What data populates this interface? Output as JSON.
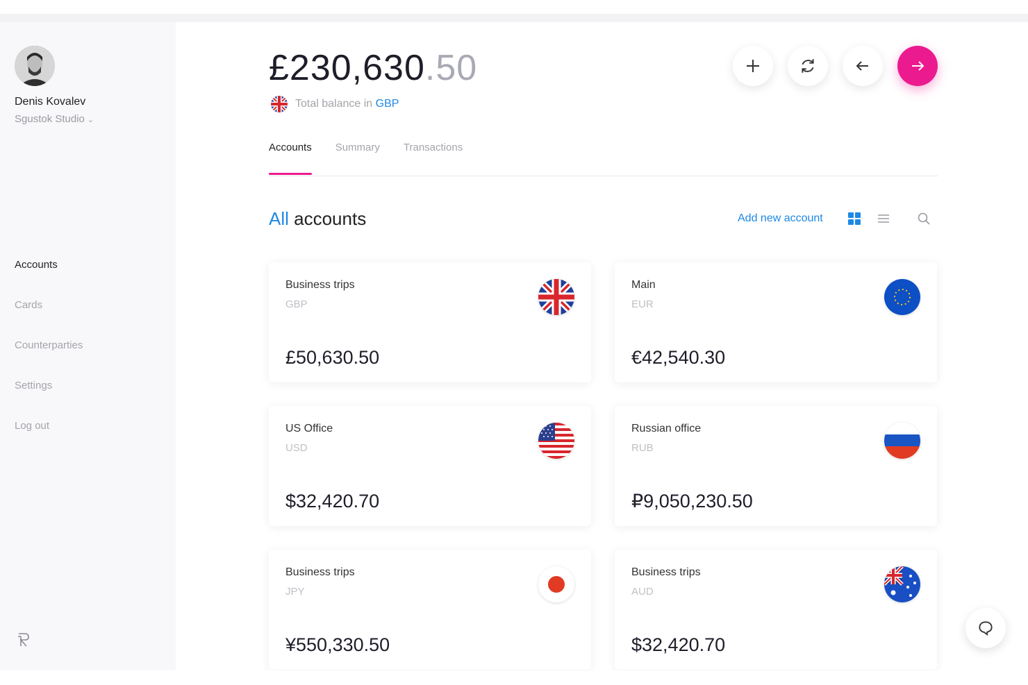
{
  "user": {
    "name": "Denis Kovalev",
    "org": "Sgustok Studio"
  },
  "nav": {
    "accounts": "Accounts",
    "cards": "Cards",
    "counterparties": "Counterparties",
    "settings": "Settings",
    "logout": "Log out"
  },
  "balance": {
    "whole": "£230,630",
    "cents": ".50",
    "label": "Total balance in",
    "currency": "GBP"
  },
  "tabs": {
    "accounts": "Accounts",
    "summary": "Summary",
    "transactions": "Transactions"
  },
  "section": {
    "highlight": "All",
    "rest": " accounts",
    "add_label": "Add new account"
  },
  "accounts": [
    {
      "name": "Business trips",
      "code": "GBP",
      "amount": "£50,630.50",
      "flag": "uk-flag-icon"
    },
    {
      "name": "Main",
      "code": "EUR",
      "amount": "€42,540.30",
      "flag": "eu-flag-icon"
    },
    {
      "name": "US Office",
      "code": "USD",
      "amount": "$32,420.70",
      "flag": "us-flag-icon"
    },
    {
      "name": "Russian office",
      "code": "RUB",
      "amount": "₽9,050,230.50",
      "flag": "russia-flag-icon"
    },
    {
      "name": "Business trips",
      "code": "JPY",
      "amount": "¥550,330.50",
      "flag": "japan-flag-icon"
    },
    {
      "name": "Business trips",
      "code": "AUD",
      "amount": "$32,420.70",
      "flag": "australia-flag-icon"
    }
  ],
  "colors": {
    "accent": "#ec1a8f",
    "link": "#1e88e5",
    "sidebar_bg": "#f8f8fa"
  }
}
